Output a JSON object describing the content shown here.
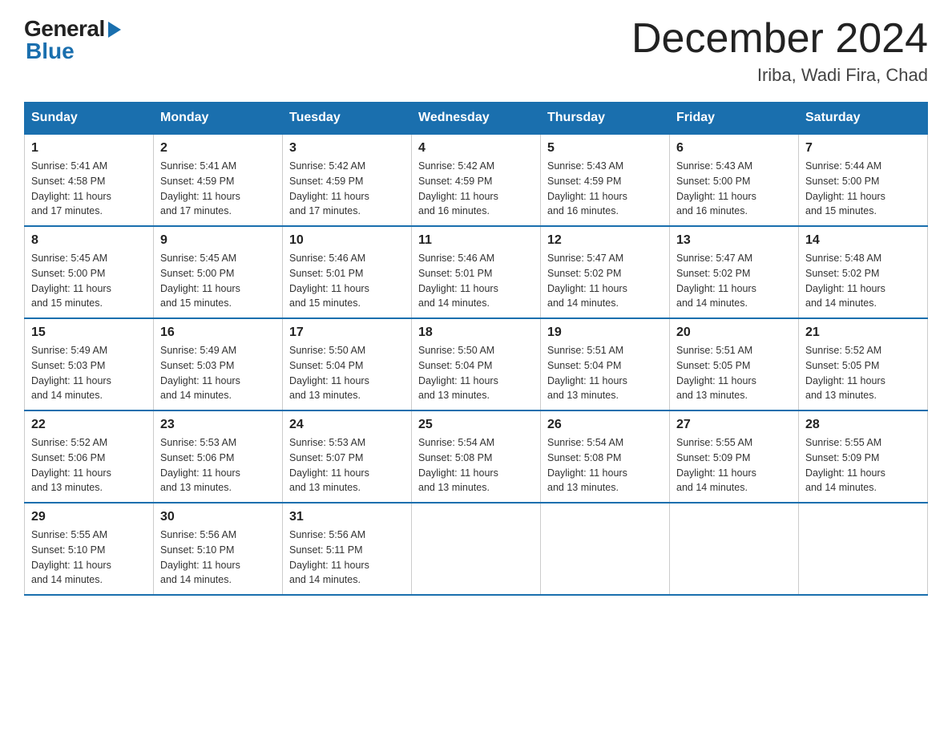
{
  "header": {
    "logo_general": "General",
    "logo_blue": "Blue",
    "month_title": "December 2024",
    "location": "Iriba, Wadi Fira, Chad"
  },
  "days_of_week": [
    "Sunday",
    "Monday",
    "Tuesday",
    "Wednesday",
    "Thursday",
    "Friday",
    "Saturday"
  ],
  "weeks": [
    [
      {
        "day": "1",
        "sunrise": "5:41 AM",
        "sunset": "4:58 PM",
        "daylight": "11 hours and 17 minutes."
      },
      {
        "day": "2",
        "sunrise": "5:41 AM",
        "sunset": "4:59 PM",
        "daylight": "11 hours and 17 minutes."
      },
      {
        "day": "3",
        "sunrise": "5:42 AM",
        "sunset": "4:59 PM",
        "daylight": "11 hours and 17 minutes."
      },
      {
        "day": "4",
        "sunrise": "5:42 AM",
        "sunset": "4:59 PM",
        "daylight": "11 hours and 16 minutes."
      },
      {
        "day": "5",
        "sunrise": "5:43 AM",
        "sunset": "4:59 PM",
        "daylight": "11 hours and 16 minutes."
      },
      {
        "day": "6",
        "sunrise": "5:43 AM",
        "sunset": "5:00 PM",
        "daylight": "11 hours and 16 minutes."
      },
      {
        "day": "7",
        "sunrise": "5:44 AM",
        "sunset": "5:00 PM",
        "daylight": "11 hours and 15 minutes."
      }
    ],
    [
      {
        "day": "8",
        "sunrise": "5:45 AM",
        "sunset": "5:00 PM",
        "daylight": "11 hours and 15 minutes."
      },
      {
        "day": "9",
        "sunrise": "5:45 AM",
        "sunset": "5:00 PM",
        "daylight": "11 hours and 15 minutes."
      },
      {
        "day": "10",
        "sunrise": "5:46 AM",
        "sunset": "5:01 PM",
        "daylight": "11 hours and 15 minutes."
      },
      {
        "day": "11",
        "sunrise": "5:46 AM",
        "sunset": "5:01 PM",
        "daylight": "11 hours and 14 minutes."
      },
      {
        "day": "12",
        "sunrise": "5:47 AM",
        "sunset": "5:02 PM",
        "daylight": "11 hours and 14 minutes."
      },
      {
        "day": "13",
        "sunrise": "5:47 AM",
        "sunset": "5:02 PM",
        "daylight": "11 hours and 14 minutes."
      },
      {
        "day": "14",
        "sunrise": "5:48 AM",
        "sunset": "5:02 PM",
        "daylight": "11 hours and 14 minutes."
      }
    ],
    [
      {
        "day": "15",
        "sunrise": "5:49 AM",
        "sunset": "5:03 PM",
        "daylight": "11 hours and 14 minutes."
      },
      {
        "day": "16",
        "sunrise": "5:49 AM",
        "sunset": "5:03 PM",
        "daylight": "11 hours and 14 minutes."
      },
      {
        "day": "17",
        "sunrise": "5:50 AM",
        "sunset": "5:04 PM",
        "daylight": "11 hours and 13 minutes."
      },
      {
        "day": "18",
        "sunrise": "5:50 AM",
        "sunset": "5:04 PM",
        "daylight": "11 hours and 13 minutes."
      },
      {
        "day": "19",
        "sunrise": "5:51 AM",
        "sunset": "5:04 PM",
        "daylight": "11 hours and 13 minutes."
      },
      {
        "day": "20",
        "sunrise": "5:51 AM",
        "sunset": "5:05 PM",
        "daylight": "11 hours and 13 minutes."
      },
      {
        "day": "21",
        "sunrise": "5:52 AM",
        "sunset": "5:05 PM",
        "daylight": "11 hours and 13 minutes."
      }
    ],
    [
      {
        "day": "22",
        "sunrise": "5:52 AM",
        "sunset": "5:06 PM",
        "daylight": "11 hours and 13 minutes."
      },
      {
        "day": "23",
        "sunrise": "5:53 AM",
        "sunset": "5:06 PM",
        "daylight": "11 hours and 13 minutes."
      },
      {
        "day": "24",
        "sunrise": "5:53 AM",
        "sunset": "5:07 PM",
        "daylight": "11 hours and 13 minutes."
      },
      {
        "day": "25",
        "sunrise": "5:54 AM",
        "sunset": "5:08 PM",
        "daylight": "11 hours and 13 minutes."
      },
      {
        "day": "26",
        "sunrise": "5:54 AM",
        "sunset": "5:08 PM",
        "daylight": "11 hours and 13 minutes."
      },
      {
        "day": "27",
        "sunrise": "5:55 AM",
        "sunset": "5:09 PM",
        "daylight": "11 hours and 14 minutes."
      },
      {
        "day": "28",
        "sunrise": "5:55 AM",
        "sunset": "5:09 PM",
        "daylight": "11 hours and 14 minutes."
      }
    ],
    [
      {
        "day": "29",
        "sunrise": "5:55 AM",
        "sunset": "5:10 PM",
        "daylight": "11 hours and 14 minutes."
      },
      {
        "day": "30",
        "sunrise": "5:56 AM",
        "sunset": "5:10 PM",
        "daylight": "11 hours and 14 minutes."
      },
      {
        "day": "31",
        "sunrise": "5:56 AM",
        "sunset": "5:11 PM",
        "daylight": "11 hours and 14 minutes."
      },
      null,
      null,
      null,
      null
    ]
  ]
}
